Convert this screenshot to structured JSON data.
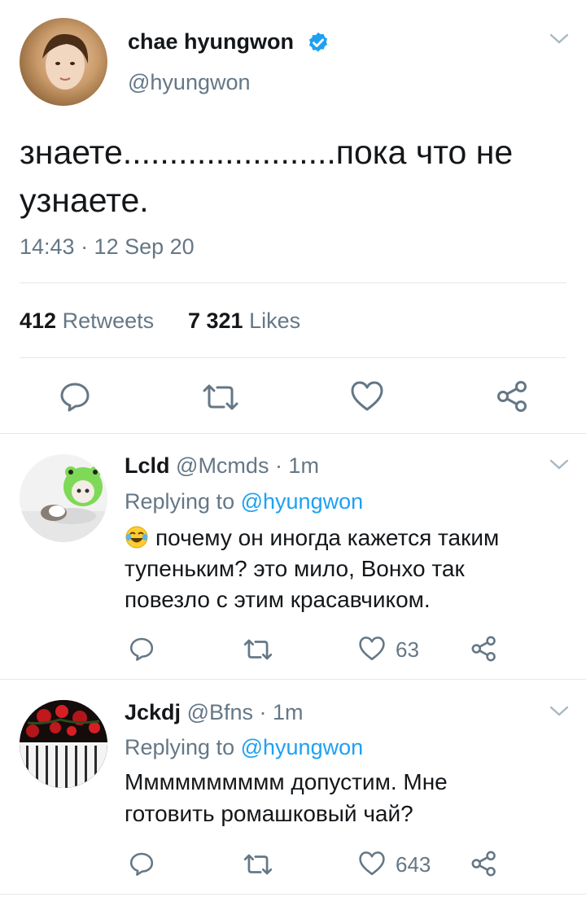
{
  "main_tweet": {
    "display_name": "chae hyungwon",
    "handle": "@hyungwon",
    "verified_icon": "verified-badge-icon",
    "text_line1": "знаете.......................пока что не",
    "text_line2": "узнаете.",
    "timestamp": "14:43 · 12 Sep 20",
    "retweets_count": "412",
    "retweets_label": "Retweets",
    "likes_count": "7 321",
    "likes_label": "Likes",
    "actions": [
      "reply-icon",
      "retweet-icon",
      "like-icon",
      "share-icon"
    ]
  },
  "replies": [
    {
      "display_name": "Lcld",
      "handle_time": "@Mcmds · 1m",
      "replying_prefix": "Replying to",
      "replying_to": "@hyungwon",
      "emoji": "😂",
      "text_line1": "почему он иногда кажется таким",
      "text_line2": "тупеньким? это мило, Вонхо так",
      "text_line3": "повезло с этим красавчиком.",
      "likes": "63"
    },
    {
      "display_name": "Jckdj",
      "handle_time": "@Bfns · 1m",
      "replying_prefix": "Replying to",
      "replying_to": "@hyungwon",
      "text_line1": "Мммммммммм допустим. Мне",
      "text_line2": "готовить ромашковый чай?",
      "likes": "643"
    }
  ],
  "colors": {
    "accent": "#1da1f2",
    "text": "#14171a",
    "muted": "#657786",
    "divider": "#e1e8ed",
    "icon": "#657786"
  }
}
